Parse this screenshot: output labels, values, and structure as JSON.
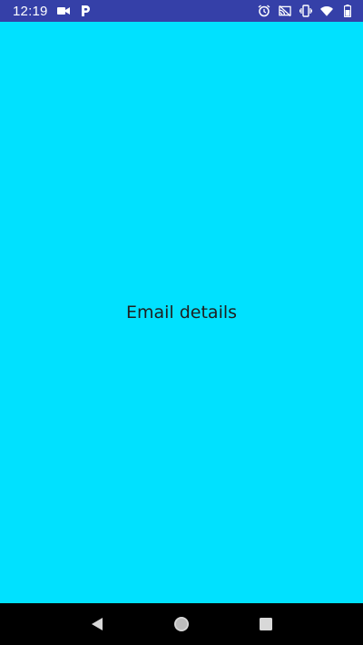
{
  "status_bar": {
    "time": "12:19",
    "left_icons": [
      "video-camera-icon",
      "parking-icon"
    ],
    "right_icons": [
      "alarm-icon",
      "no-cast-icon",
      "vibrate-icon",
      "wifi-icon",
      "battery-icon"
    ],
    "background_color": "#3540a8"
  },
  "main": {
    "title": "Email details",
    "background_color": "#00e1ff"
  },
  "nav_bar": {
    "buttons": [
      "back-icon",
      "home-icon",
      "recents-icon"
    ],
    "background_color": "#000000"
  }
}
